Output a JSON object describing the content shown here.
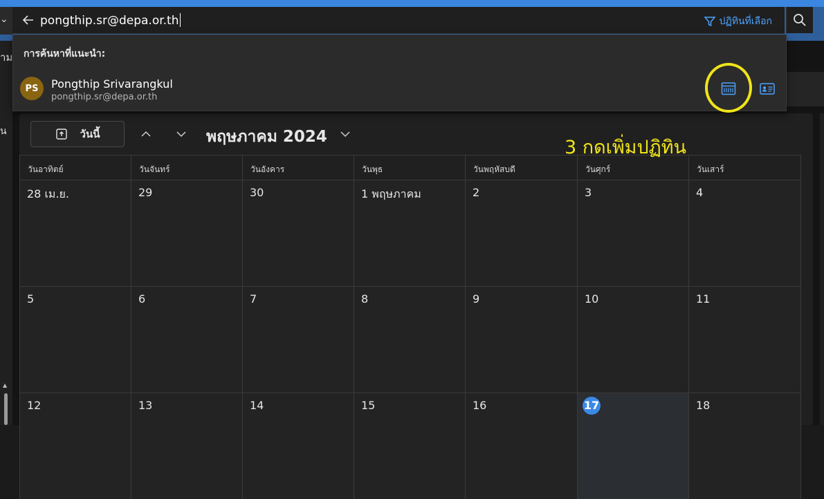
{
  "search": {
    "query": "pongthip.sr@depa.or.th",
    "filter_label": "ปฏิทินที่เลือก"
  },
  "left_nav": {
    "label_top": "าม",
    "label_mid": "น"
  },
  "suggestions": {
    "heading": "การค้นหาที่แนะนำ:",
    "items": [
      {
        "initials": "PS",
        "name": "Pongthip Srivarangkul",
        "email": "pongthip.sr@depa.or.th",
        "avatar_color": "#8a6511"
      }
    ]
  },
  "annotation": {
    "text": "3 กดเพิ่มปฏิทิน",
    "color": "#f0e41a"
  },
  "calendar": {
    "today_label": "วันนี้",
    "month_label": "พฤษภาคม 2024",
    "weekdays": [
      "วันอาทิตย์",
      "วันจันทร์",
      "วันอังคาร",
      "วันพุธ",
      "วันพฤหัสบดี",
      "วันศุกร์",
      "วันเสาร์"
    ],
    "weeks": [
      [
        "28 เม.ย.",
        "29",
        "30",
        "1 พฤษภาคม",
        "2",
        "3",
        "4"
      ],
      [
        "5",
        "6",
        "7",
        "8",
        "9",
        "10",
        "11"
      ],
      [
        "12",
        "13",
        "14",
        "15",
        "16",
        "17",
        "18"
      ]
    ],
    "current_day": "17",
    "accent_color": "#3b89e6"
  },
  "icons": {
    "back": "arrow-left-icon",
    "filter": "filter-icon",
    "search": "search-icon",
    "add_calendar": "calendar-icon",
    "contact_card": "contact-card-icon",
    "today": "calendar-today-icon",
    "prev": "chevron-up-icon",
    "next": "chevron-down-icon",
    "month_picker": "chevron-down-icon"
  }
}
